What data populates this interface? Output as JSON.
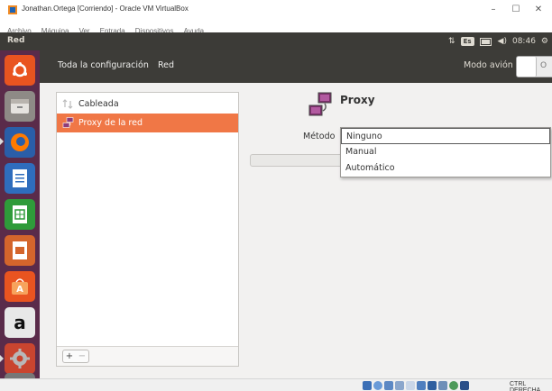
{
  "vbox": {
    "title": "Jonathan.Ortega [Corriendo] - Oracle VM VirtualBox",
    "menu": [
      "Archivo",
      "Máquina",
      "Ver",
      "Entrada",
      "Dispositivos",
      "Ayuda"
    ],
    "window_controls": {
      "minimize": "–",
      "maximize": "☐",
      "close": "✕"
    },
    "host_key": "CTRL DERECHA"
  },
  "panel": {
    "title": "Red",
    "keyboard_layout": "Es",
    "time": "08:46"
  },
  "launcher": {
    "items": [
      {
        "icon": "ubuntu-dash-icon"
      },
      {
        "icon": "files-icon"
      },
      {
        "icon": "firefox-icon"
      },
      {
        "icon": "libreoffice-writer-icon"
      },
      {
        "icon": "libreoffice-calc-icon"
      },
      {
        "icon": "libreoffice-impress-icon"
      },
      {
        "icon": "ubuntu-software-icon"
      },
      {
        "icon": "amazon-icon",
        "glyph": "a"
      },
      {
        "icon": "system-settings-icon"
      }
    ]
  },
  "header": {
    "all_settings": "Toda la configuración",
    "section": "Red",
    "airplane_mode": "Modo avión",
    "airplane_toggle": "O"
  },
  "devices": {
    "items": [
      {
        "label": "Cableada",
        "icon": "wired-network-icon"
      },
      {
        "label": "Proxy de la red",
        "icon": "network-proxy-icon"
      }
    ],
    "add_label": "+",
    "remove_label": "−"
  },
  "proxy": {
    "title": "Proxy",
    "method_label": "Método",
    "options": [
      "Ninguno",
      "Manual",
      "Automático"
    ],
    "selected": "Ninguno"
  },
  "colors": {
    "accent": "#f07746",
    "launcher_bg": "#5a2b4a",
    "panel_bg": "#3c3b37",
    "header_bg": "#3d3c38"
  }
}
